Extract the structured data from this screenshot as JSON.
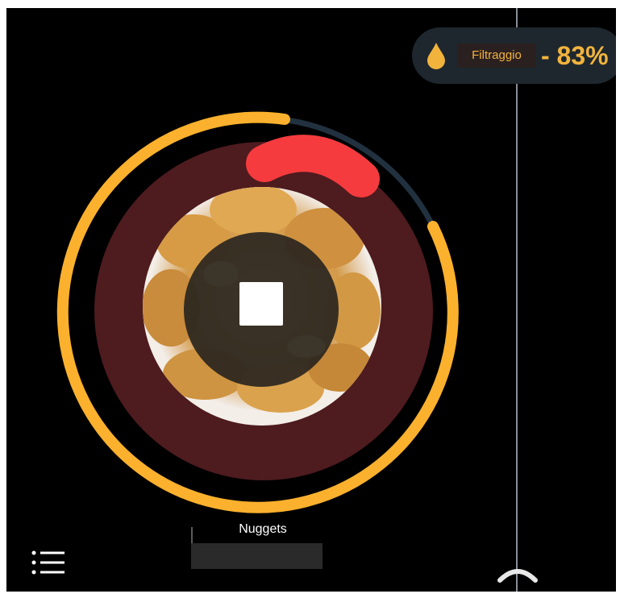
{
  "filter": {
    "label": "Filtraggio",
    "value": "- 83%",
    "icon": "drop-icon",
    "accent_color": "#f2b33d",
    "pill_color": "#1e272e"
  },
  "cooking": {
    "program_name": "Nuggets",
    "food_image": "chicken-nuggets-photo",
    "progress_ring_color": "#fbb12d",
    "remaining_ring_color": "#22313f",
    "disk_color": "#4e1b1e",
    "heat_marker_color": "#f53b3e"
  },
  "controls": {
    "stop_icon": "stop-icon",
    "menu_icon": "menu-icon",
    "expand_icon": "chevron-up-icon"
  }
}
